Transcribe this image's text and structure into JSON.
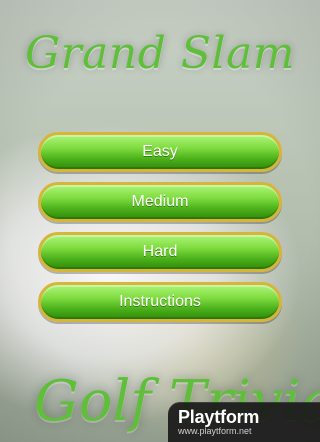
{
  "titles": {
    "top": "Grand Slam",
    "bottom": "Golf Trivia"
  },
  "menu": {
    "items": [
      {
        "label": "Easy"
      },
      {
        "label": "Medium"
      },
      {
        "label": "Hard"
      },
      {
        "label": "Instructions"
      }
    ]
  },
  "watermark": {
    "brand": "Playtform",
    "url": "www.playtform.net"
  },
  "theme": {
    "button_green": "#4cb11b",
    "button_gold": "#d6b53a",
    "title_green": "#5fbf3b"
  }
}
